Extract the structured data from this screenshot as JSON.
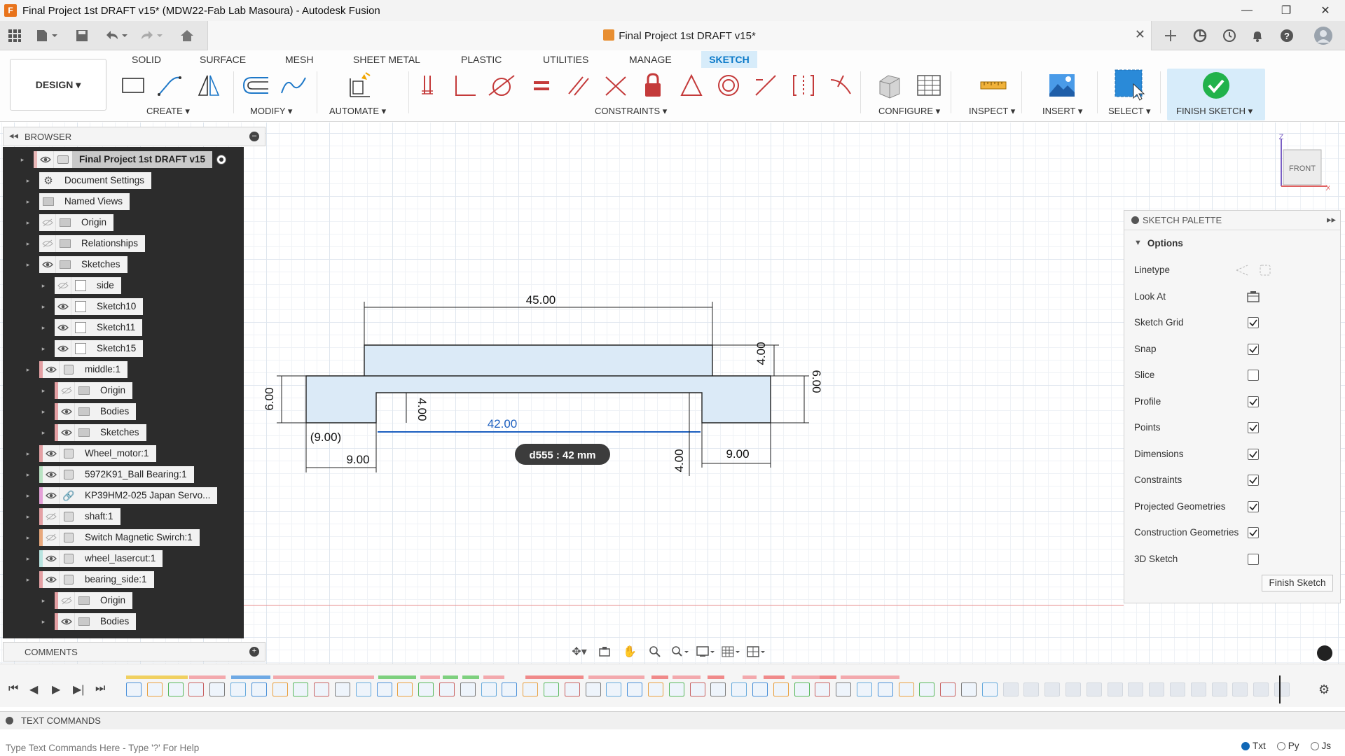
{
  "window": {
    "title": "Final Project 1st DRAFT v15* (MDW22-Fab Lab Masoura) - Autodesk Fusion",
    "app_icon": "F",
    "minimize": "—",
    "maximize": "❐",
    "close": "✕"
  },
  "document_tab": {
    "title": "Final Project 1st DRAFT v15*",
    "close": "✕"
  },
  "workspace": {
    "label": "DESIGN ▾"
  },
  "tabs": [
    {
      "label": "SOLID",
      "active": false
    },
    {
      "label": "SURFACE",
      "active": false
    },
    {
      "label": "MESH",
      "active": false
    },
    {
      "label": "SHEET METAL",
      "active": false
    },
    {
      "label": "PLASTIC",
      "active": false
    },
    {
      "label": "UTILITIES",
      "active": false
    },
    {
      "label": "MANAGE",
      "active": false
    },
    {
      "label": "SKETCH",
      "active": true
    }
  ],
  "toolbar_groups": {
    "create": "CREATE ▾",
    "modify": "MODIFY ▾",
    "automate": "AUTOMATE ▾",
    "constraints": "CONSTRAINTS ▾",
    "configure": "CONFIGURE ▾",
    "inspect": "INSPECT ▾",
    "insert": "INSERT ▾",
    "select": "SELECT ▾",
    "finish_sketch": "FINISH SKETCH ▾"
  },
  "browser": {
    "title": "BROWSER",
    "items": [
      {
        "label": "Final Project 1st DRAFT v15",
        "icon": "document-icon",
        "eye": "visible"
      },
      {
        "label": "Document Settings",
        "icon": "gear-icon",
        "eye": "none"
      },
      {
        "label": "Named Views",
        "icon": "folder-icon",
        "eye": "none"
      },
      {
        "label": "Origin",
        "icon": "folder-icon",
        "eye": "hidden"
      },
      {
        "label": "Relationships",
        "icon": "folder-icon",
        "eye": "hidden"
      },
      {
        "label": "Sketches",
        "icon": "folder-icon",
        "eye": "visible"
      },
      {
        "label": "side",
        "icon": "sketch-icon",
        "eye": "hidden"
      },
      {
        "label": "Sketch10",
        "icon": "sketch-icon",
        "eye": "visible"
      },
      {
        "label": "Sketch11",
        "icon": "sketch-icon",
        "eye": "visible"
      },
      {
        "label": "Sketch15",
        "icon": "sketch-icon",
        "eye": "visible"
      },
      {
        "label": "middle:1",
        "icon": "component-icon",
        "eye": "visible"
      },
      {
        "label": "Origin",
        "icon": "folder-icon",
        "eye": "hidden"
      },
      {
        "label": "Bodies",
        "icon": "folder-icon",
        "eye": "visible"
      },
      {
        "label": "Sketches",
        "icon": "folder-icon",
        "eye": "visible"
      },
      {
        "label": "Wheel_motor:1",
        "icon": "component-icon",
        "eye": "visible"
      },
      {
        "label": "5972K91_Ball Bearing:1",
        "icon": "component-icon",
        "eye": "visible"
      },
      {
        "label": "KP39HM2-025 Japan Servo...",
        "icon": "link-icon",
        "eye": "visible"
      },
      {
        "label": "shaft:1",
        "icon": "component-icon",
        "eye": "hidden"
      },
      {
        "label": "Switch Magnetic Swirch:1",
        "icon": "component-icon",
        "eye": "hidden"
      },
      {
        "label": "wheel_lasercut:1",
        "icon": "component-icon",
        "eye": "visible"
      },
      {
        "label": "bearing_side:1",
        "icon": "component-icon",
        "eye": "visible"
      },
      {
        "label": "Origin",
        "icon": "folder-icon",
        "eye": "hidden"
      },
      {
        "label": "Bodies",
        "icon": "folder-icon",
        "eye": "visible"
      }
    ]
  },
  "comments": {
    "title": "COMMENTS"
  },
  "sketch_dimensions": {
    "top_width": "45.00",
    "slot_width": "42.00",
    "left_height": "6.00",
    "right_height": "6.00",
    "top_thickness": "4.00",
    "slot_depth": "4.00",
    "left_offset": "(9.00)",
    "left_bottom": "9.00",
    "right_bottom": "9.00",
    "bottom_vertical": "4.00",
    "tooltip": "d555 : 42 mm"
  },
  "sketch_palette": {
    "title": "SKETCH PALETTE",
    "section": "Options",
    "options": [
      {
        "label": "Linetype",
        "control": "linetype",
        "checked": null
      },
      {
        "label": "Look At",
        "control": "lookat",
        "checked": null
      },
      {
        "label": "Sketch Grid",
        "control": "checkbox",
        "checked": true
      },
      {
        "label": "Snap",
        "control": "checkbox",
        "checked": true
      },
      {
        "label": "Slice",
        "control": "checkbox",
        "checked": false
      },
      {
        "label": "Profile",
        "control": "checkbox",
        "checked": true
      },
      {
        "label": "Points",
        "control": "checkbox",
        "checked": true
      },
      {
        "label": "Dimensions",
        "control": "checkbox",
        "checked": true
      },
      {
        "label": "Constraints",
        "control": "checkbox",
        "checked": true
      },
      {
        "label": "Projected Geometries",
        "control": "checkbox",
        "checked": true
      },
      {
        "label": "Construction Geometries",
        "control": "checkbox",
        "checked": true
      },
      {
        "label": "3D Sketch",
        "control": "checkbox",
        "checked": false
      }
    ],
    "finish_button": "Finish Sketch"
  },
  "viewcube": {
    "face": "FRONT",
    "z": "Z",
    "x": "X"
  },
  "text_commands": {
    "title": "TEXT COMMANDS",
    "placeholder": "Type Text Commands Here - Type '?' For Help",
    "modes": [
      "Txt",
      "Py",
      "Js"
    ],
    "selected_mode": "Txt"
  },
  "colors": {
    "accent": "#0a79c8",
    "active_tab_bg": "#d7ecfa",
    "sketch_line": "#111111",
    "profile_fill": "#dbeaf7",
    "dimension_selected": "#1c5fbf",
    "finish_check": "#21b24b"
  }
}
